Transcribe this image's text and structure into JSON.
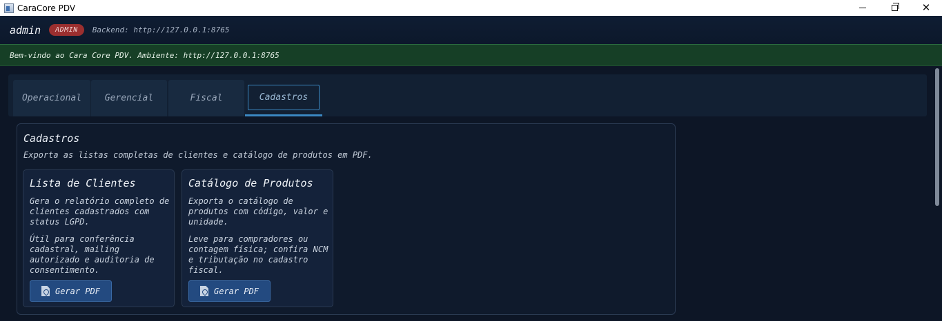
{
  "window": {
    "title": "CaraCore PDV",
    "icons": {
      "app": "app-window-icon",
      "minimize": "minimize-icon",
      "maximize": "restore-icon",
      "close": "close-icon"
    }
  },
  "header": {
    "user": "admin",
    "role_badge": "ADMIN",
    "backend": "Backend: http://127.0.0.1:8765",
    "badge_color": "#9b2f2f"
  },
  "banner": {
    "message": "Bem-vindo ao Cara Core PDV. Ambiente: http://127.0.0.1:8765",
    "color": "#163f26"
  },
  "tabs": [
    {
      "label": "Operacional",
      "active": false
    },
    {
      "label": "Gerencial",
      "active": false
    },
    {
      "label": "Fiscal",
      "active": false
    },
    {
      "label": "Cadastros",
      "active": true
    }
  ],
  "panel": {
    "title": "Cadastros",
    "description": "Exporta as listas completas de clientes e catálogo de produtos em PDF.",
    "cards": [
      {
        "title": "Lista de Clientes",
        "paragraph1": "Gera o relatório completo de clientes cadastrados com status LGPD.",
        "paragraph2": "Útil para conferência cadastral, mailing autorizado e auditoria de consentimento.",
        "button": "Gerar PDF",
        "button_icon": "pdf-file-icon"
      },
      {
        "title": "Catálogo de Produtos",
        "paragraph1": "Exporta o catálogo de produtos com código, valor e unidade.",
        "paragraph2": "Leve para compradores ou contagem física; confira NCM e tributação no cadastro fiscal.",
        "button": "Gerar PDF",
        "button_icon": "pdf-file-icon"
      }
    ]
  },
  "accent_color": "#3b88c2"
}
